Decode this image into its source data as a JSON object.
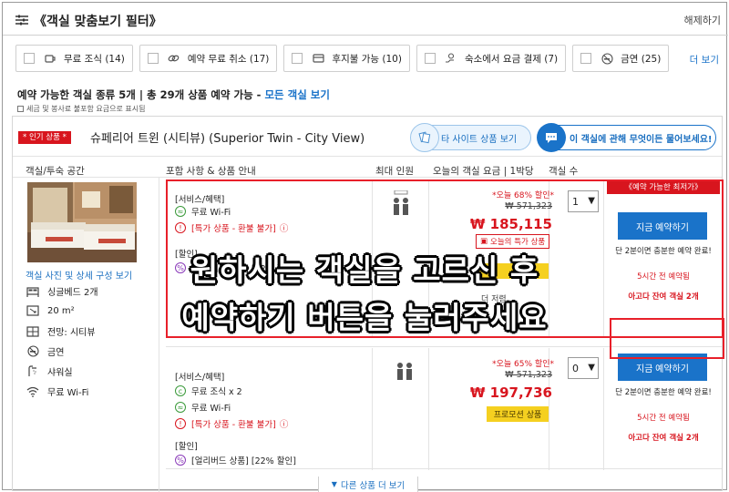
{
  "topbar": {
    "title": "《객실 맞춤보기 필터》",
    "reset": "해제하기"
  },
  "filters": [
    {
      "label": "무료 조식 (14)",
      "icon": "coffee-icon"
    },
    {
      "label": "예약 무료 취소 (17)",
      "icon": "link-icon"
    },
    {
      "label": "후지불 가능 (10)",
      "icon": "card-icon"
    },
    {
      "label": "숙소에서 요금 결제 (7)",
      "icon": "hand-coin-icon"
    },
    {
      "label": "금연 (25)",
      "icon": "no-smoking-icon"
    }
  ],
  "more_filters": "더 보기",
  "summary": {
    "text": "예약 가능한 객실 종류 5개 | 총 29개 상품 예약 가능 - ",
    "link": "모든 객실 보기",
    "note": "세금 및 봉사료 불포함 요금으로 표시됨"
  },
  "room": {
    "badge": "* 인기 상품 *",
    "name": "슈페리어 트윈 (시티뷰) (Superior Twin - City View)",
    "other_site": "타 사이트 상품 보기",
    "ask": "이 객실에 관해 무엇이든 물어보세요!",
    "photo_link": "객실 사진 및 상세 구성 보기",
    "features": [
      {
        "label": "싱글베드 2개",
        "icon": "bed-icon"
      },
      {
        "label": "20 m²",
        "icon": "area-icon"
      },
      {
        "label": "전망: 시티뷰",
        "icon": "view-icon"
      },
      {
        "label": "금연",
        "icon": "no-smoking-icon"
      },
      {
        "label": "샤워실",
        "icon": "shower-icon"
      },
      {
        "label": "무료 Wi-Fi",
        "icon": "wifi-icon"
      }
    ]
  },
  "columns": {
    "room_type": "객실/투숙 공간",
    "includes": "포함 사항 & 상품 안내",
    "max_guests": "최대 인원",
    "price": "오늘의 객실 요금 | 1박당",
    "rooms": "객실 수"
  },
  "offers": [
    {
      "services_label": "[서비스/혜택]",
      "services": [
        "무료 Wi-Fi",
        "[특가 상품 - 환불 불가]"
      ],
      "discount_label": "[할인]",
      "discount_item": "[얼리버드 상품] [22% 할인]",
      "discount": "*오늘 68% 할인*",
      "old_price": "₩ 571,323",
      "price": "₩ 185,115",
      "deal_tag": "오늘의 특가 상품",
      "extra_text": "더 저렴",
      "qty": "1",
      "lowest_tag": "《예약 가능한 최저가》",
      "book": "지금 예약하기",
      "note": "단 2분이면 충분한 예약 완료!",
      "recent": "5시간 전 예약됨",
      "remaining": "아고다 잔여 객실 2개"
    },
    {
      "services_label": "[서비스/혜택]",
      "services": [
        "무료 조식 x 2",
        "무료 Wi-Fi",
        "[특가 상품 - 환불 불가]"
      ],
      "discount_label": "[할인]",
      "discount_item": "[얼리버드 상품] [22% 할인]",
      "discount": "*오늘 65% 할인*",
      "old_price": "₩ 571,323",
      "price": "₩ 197,736",
      "promo": "프로모션 상품",
      "qty": "0",
      "book": "지금 예약하기",
      "note": "단 2분이면 충분한 예약 완료!",
      "recent": "5시간 전 예약됨",
      "remaining": "아고다 잔여 객실 2개"
    }
  ],
  "more_products": "다른 상품 더 보기",
  "caption": {
    "line1": "원하시는 객실을 고르신 후",
    "line2": "예약하기 버튼을 눌러주세요"
  },
  "colors": {
    "accent": "#1a73c9",
    "red": "#d8151e",
    "promo": "#f5d020"
  }
}
